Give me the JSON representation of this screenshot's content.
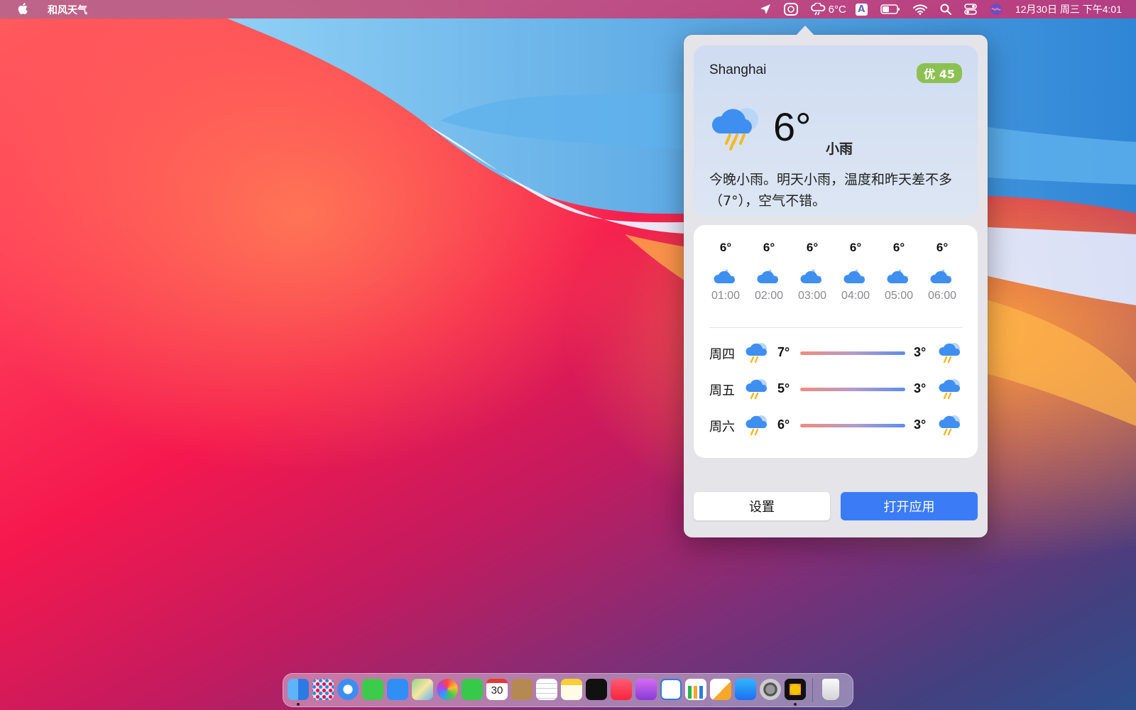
{
  "menubar": {
    "app_name": "和风天气",
    "weather_temp": "6°C",
    "input_source": "A",
    "datetime": "12月30日 周三 下午4:01"
  },
  "popover": {
    "city": "Shanghai",
    "aqi": "优 45",
    "temperature": "6°",
    "condition": "小雨",
    "summary": "今晚小雨。明天小雨，温度和昨天差不多（7°），空气不错。",
    "hourly": [
      {
        "temp": "6°",
        "time": "01:00"
      },
      {
        "temp": "6°",
        "time": "02:00"
      },
      {
        "temp": "6°",
        "time": "03:00"
      },
      {
        "temp": "6°",
        "time": "04:00"
      },
      {
        "temp": "6°",
        "time": "05:00"
      },
      {
        "temp": "6°",
        "time": "06:00"
      }
    ],
    "daily": [
      {
        "day": "周四",
        "high": "7°",
        "low": "3°"
      },
      {
        "day": "周五",
        "high": "5°",
        "low": "3°"
      },
      {
        "day": "周六",
        "high": "6°",
        "low": "3°"
      }
    ],
    "settings_label": "设置",
    "open_app_label": "打开应用"
  },
  "dock": {
    "calendar_day": "30",
    "apps": [
      "finder-icon",
      "launchpad-icon",
      "safari-icon",
      "messages-icon",
      "mail-icon",
      "maps-icon",
      "photos-icon",
      "facetime-icon",
      "calendar-icon",
      "contacts-icon",
      "reminders-icon",
      "notes-icon",
      "apple-tv-icon",
      "music-icon",
      "podcasts-icon",
      "keynote-icon",
      "numbers-icon",
      "pages-icon",
      "app-store-icon",
      "system-preferences-icon",
      "weather-app-icon",
      "trash-icon"
    ]
  },
  "colors": {
    "accent": "#3b7cf6",
    "aqi_badge": "#8cc152"
  }
}
